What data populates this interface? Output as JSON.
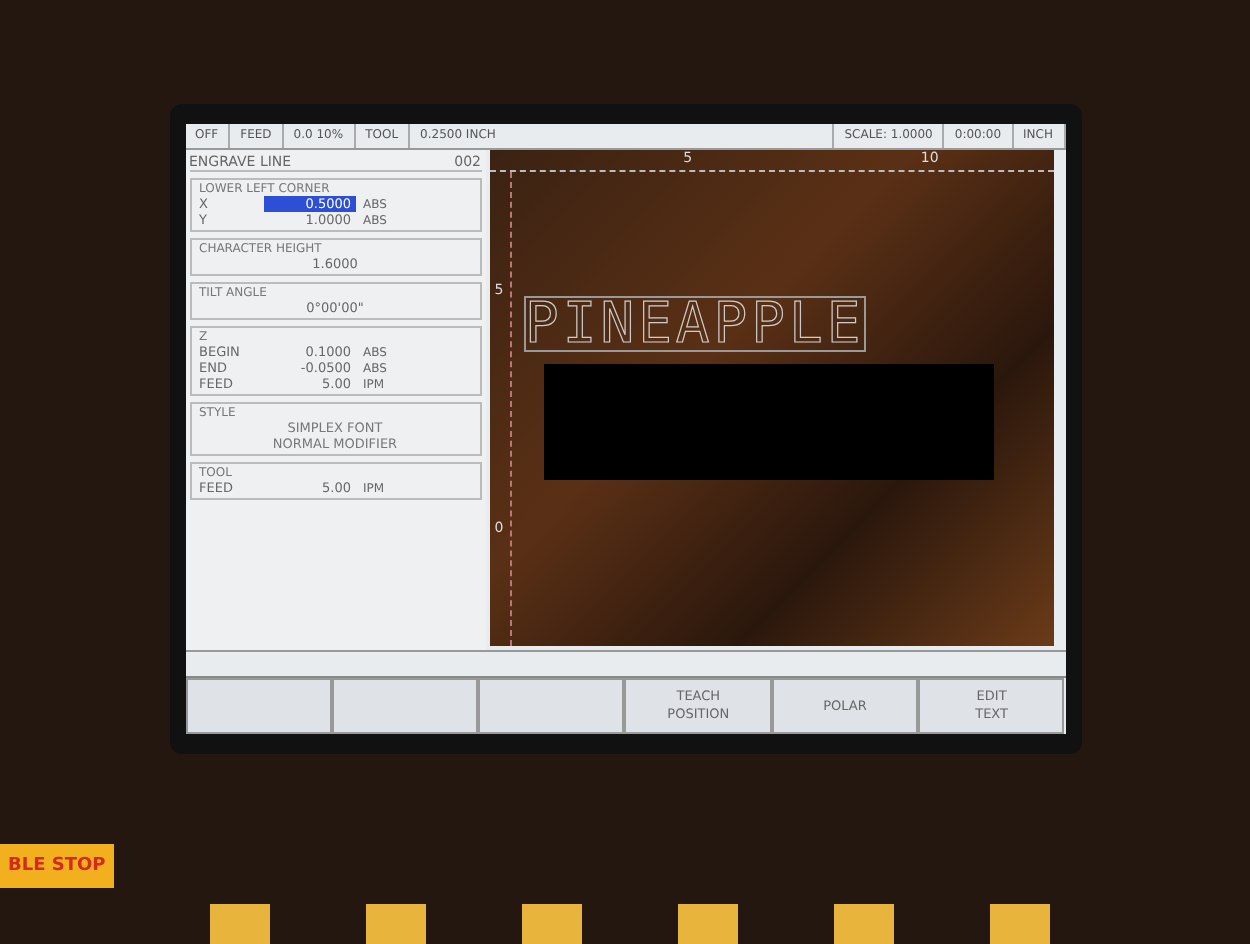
{
  "status_bar": [
    {
      "text": "OFF"
    },
    {
      "text": "FEED"
    },
    {
      "text": "0.0 10%"
    },
    {
      "text": "TOOL"
    },
    {
      "text": "0.2500 INCH"
    },
    {
      "text": "SCALE: 1.0000"
    },
    {
      "text": "0:00:00"
    },
    {
      "text": "INCH"
    }
  ],
  "panel": {
    "title": "ENGRAVE LINE",
    "number": "002",
    "lower_left_corner": {
      "label": "LOWER LEFT CORNER",
      "fields": [
        {
          "axis": "X",
          "value": "0.5000",
          "unit": "ABS",
          "selected": true
        },
        {
          "axis": "Y",
          "value": "1.0000",
          "unit": "ABS",
          "selected": false
        }
      ]
    },
    "character_height": {
      "label": "CHARACTER HEIGHT",
      "value": "1.6000"
    },
    "tilt_angle": {
      "label": "TILT ANGLE",
      "value": "0°00'00\""
    },
    "z": {
      "label": "Z",
      "rows": [
        {
          "name": "BEGIN",
          "value": "0.1000",
          "unit": "ABS"
        },
        {
          "name": "END",
          "value": "-0.0500",
          "unit": "ABS"
        },
        {
          "name": "FEED",
          "value": "5.00",
          "unit": "IPM"
        }
      ]
    },
    "style": {
      "label": "STYLE",
      "lines": [
        "SIMPLEX FONT",
        "NORMAL MODIFIER"
      ]
    },
    "tool": {
      "label": "TOOL",
      "rows": [
        {
          "name": "FEED",
          "value": "5.00",
          "unit": "IPM"
        }
      ]
    }
  },
  "canvas": {
    "text": "PINEAPPLE",
    "top_ruler_labels": [
      "5",
      "10"
    ],
    "left_ruler_labels": [
      "5",
      "0"
    ]
  },
  "softkeys": [
    {
      "kind": "blank"
    },
    {
      "kind": "blank"
    },
    {
      "kind": "blank"
    },
    {
      "kind": "label",
      "lines": [
        "TEACH",
        "POSITION"
      ]
    },
    {
      "kind": "label",
      "lines": [
        "POLAR"
      ]
    },
    {
      "kind": "label",
      "lines": [
        "EDIT",
        "TEXT"
      ]
    }
  ],
  "console": {
    "stop_label": "BLE STOP"
  }
}
